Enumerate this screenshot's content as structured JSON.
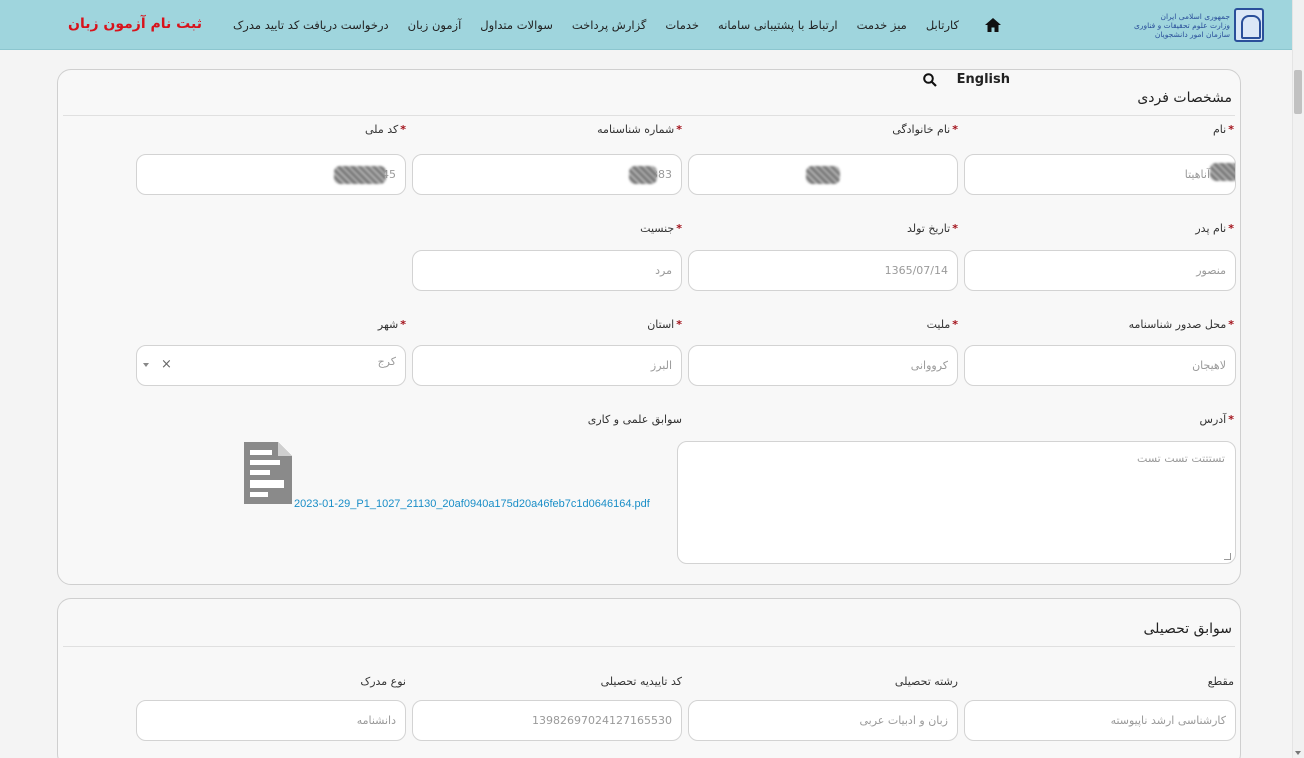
{
  "header": {
    "logo_text": [
      "جمهوری اسلامی ایران",
      "وزارت علوم تحقیقات و فناوری",
      "سازمان امور دانشجویان"
    ],
    "nav_items": [
      "کارتابل",
      "میز خدمت",
      "ارتباط با پشتیبانی سامانه",
      "خدمات",
      "گزارش پرداخت",
      "سوالات متداول",
      "آزمون زبان",
      "درخواست دریافت کد تایید مدرک"
    ],
    "register_label": "ثبت نام آزمون زبان",
    "colors": {
      "bar": "#9fd5dd",
      "register": "#d8121b"
    }
  },
  "tools": {
    "lang_label": "English",
    "search_icon": "search-icon"
  },
  "personal": {
    "title": "مشخصات فردی",
    "labels": {
      "first_name": "نام",
      "last_name": "نام خانوادگی",
      "id_number": "شماره شناسنامه",
      "national_code": "کد ملی",
      "father_name": "نام پدر",
      "birth_date": "تاریخ تولد",
      "gender": "جنسیت",
      "issue_place": "محل صدور شناسنامه",
      "nationality": "ملیت",
      "province": "استان",
      "city": "شهر",
      "address": "آدرس",
      "experience": "سوابق علمی و کاری"
    },
    "values": {
      "first_name": "آناهیتا",
      "id_number_tail": "383",
      "national_code_tail": "45",
      "father_name": "منصور",
      "birth_date": "1365/07/14",
      "gender": "مرد",
      "issue_place": "لاهیجان",
      "nationality": "کرووانی",
      "province": "البرز",
      "city": "کرج",
      "address": "تستتتت تست تست",
      "file_name": "2023-01-29_P1_1027_21130_20af0940a175d20a46feb7c1d0646164.pdf"
    }
  },
  "education": {
    "title": "سوابق تحصیلی",
    "labels": {
      "level": "مقطع",
      "field": "رشته تحصیلی",
      "confirm_code": "کد تاییدیه تحصیلی",
      "doc_type": "نوع مدرک"
    },
    "values": {
      "level": "کارشناسی ارشد ناپیوسته",
      "field": "زبان و ادبیات عربی",
      "confirm_code": "13982697024127165530",
      "doc_type": "دانشنامه"
    }
  }
}
